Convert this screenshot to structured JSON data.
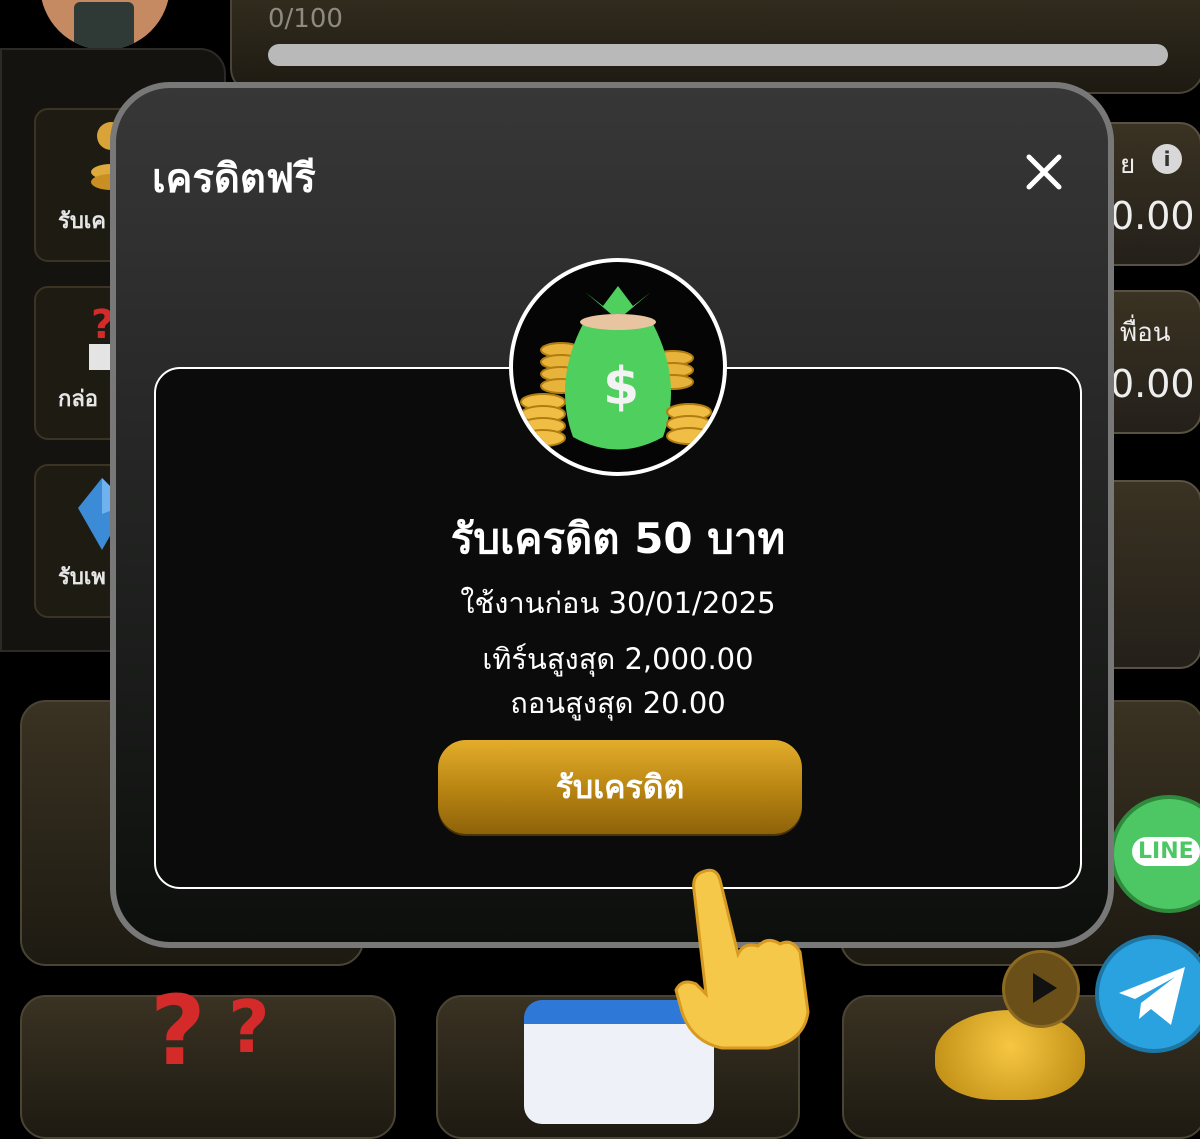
{
  "background": {
    "progress_text": "0/100",
    "side_items": [
      {
        "label": "รับเค"
      },
      {
        "label": "กล่อ"
      },
      {
        "label": "รับเพ"
      }
    ],
    "right_cards": [
      {
        "title": "ย",
        "value": "0.00"
      },
      {
        "title": "พื่อน",
        "value": "0.00"
      }
    ],
    "line_label": "LINE"
  },
  "modal": {
    "title": "เครดิตฟรี",
    "heading": "รับเครดิต 50 บาท",
    "use_before": "ใช้งานก่อน 30/01/2025",
    "max_turnover": "เทิร์นสูงสุด 2,000.00",
    "max_withdraw": "ถอนสูงสุด 20.00",
    "claim_button_label": "รับเครดิต"
  },
  "colors": {
    "button_gold": "#c9961c",
    "line_green": "#4cc764",
    "telegram_blue": "#2aa2df",
    "money_bag_green": "#4fcf5e"
  },
  "icons": [
    "close-icon",
    "money-bag-icon",
    "pointing-hand-icon",
    "line-icon",
    "telegram-icon",
    "play-icon",
    "info-icon"
  ]
}
